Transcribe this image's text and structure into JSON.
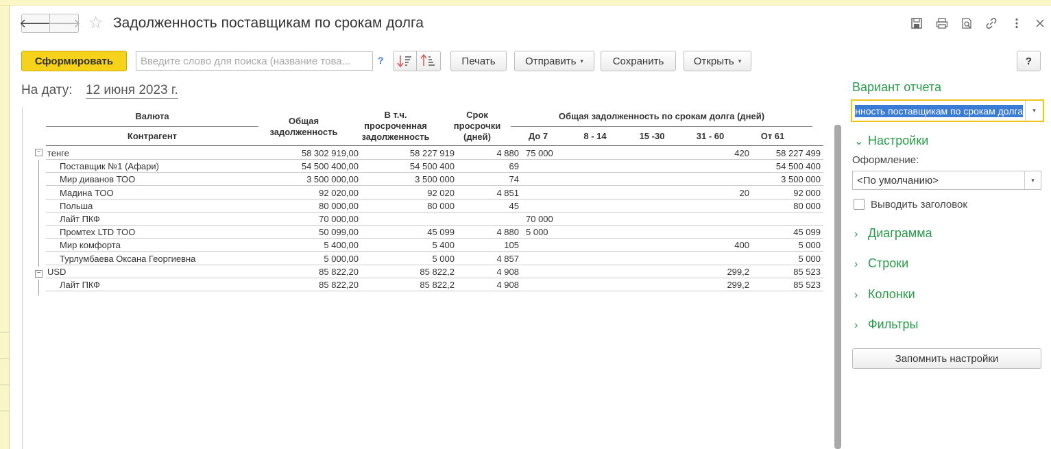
{
  "window": {
    "title": "Задолженность поставщикам по срокам долга",
    "back_glyph": "🡐",
    "forward_glyph": "🡒",
    "star_glyph": "☆",
    "icons": [
      "save-icon",
      "print-icon",
      "preview-icon",
      "link-icon",
      "more-icon",
      "close-icon"
    ]
  },
  "toolbar": {
    "generate_label": "Сформировать",
    "search_placeholder": "Введите слово для поиска (название това...",
    "search_help": "?",
    "print_label": "Печать",
    "send_label": "Отправить",
    "save_label": "Сохранить",
    "open_label": "Открыть",
    "help_label": "?",
    "caret": "▾"
  },
  "report": {
    "date_label": "На дату:",
    "date_value": "12 июня 2023 г.",
    "headers": {
      "currency": "Валюта",
      "counterparty": "Контрагент",
      "total": "Общая задолженность",
      "overdue": "В т.ч. просроченная задолженность",
      "days": "Срок просрочки (дней)",
      "group": "Общая задолженность по срокам долга (дней)",
      "b1": "До 7",
      "b2": "8 - 14",
      "b3": "15 -30",
      "b4": "31 - 60",
      "b5": "От 61"
    },
    "rows": [
      {
        "name": "тенге",
        "total": "58 302 919,00",
        "overdue": "58 227 919",
        "days": "4 880",
        "b1": "75 000",
        "b2": "",
        "b3": "",
        "b4": "420",
        "b5": "58 227 499",
        "group": true
      },
      {
        "name": "Поставщик №1 (Афари)",
        "total": "54 500 400,00",
        "overdue": "54 500 400",
        "days": "69",
        "b1": "",
        "b2": "",
        "b3": "",
        "b4": "",
        "b5": "54 500 400"
      },
      {
        "name": "Мир диванов ТОО",
        "total": "3 500 000,00",
        "overdue": "3 500 000",
        "days": "74",
        "b1": "",
        "b2": "",
        "b3": "",
        "b4": "",
        "b5": "3 500 000"
      },
      {
        "name": "Мадина ТОО",
        "total": "92 020,00",
        "overdue": "92 020",
        "days": "4 851",
        "b1": "",
        "b2": "",
        "b3": "",
        "b4": "20",
        "b5": "92 000"
      },
      {
        "name": "Польша",
        "total": "80 000,00",
        "overdue": "80 000",
        "days": "45",
        "b1": "",
        "b2": "",
        "b3": "",
        "b4": "",
        "b5": "80 000"
      },
      {
        "name": "Лайт ПКФ",
        "total": "70 000,00",
        "overdue": "",
        "days": "",
        "b1": "70 000",
        "b2": "",
        "b3": "",
        "b4": "",
        "b5": ""
      },
      {
        "name": "Промтех LTD ТОО",
        "total": "50 099,00",
        "overdue": "45 099",
        "days": "4 880",
        "b1": "5 000",
        "b2": "",
        "b3": "",
        "b4": "",
        "b5": "45 099"
      },
      {
        "name": "Мир комфорта",
        "total": "5 400,00",
        "overdue": "5 400",
        "days": "105",
        "b1": "",
        "b2": "",
        "b3": "",
        "b4": "400",
        "b5": "5 000"
      },
      {
        "name": "Турлумбаева Оксана Георгиевна",
        "total": "5 000,00",
        "overdue": "5 000",
        "days": "4 857",
        "b1": "",
        "b2": "",
        "b3": "",
        "b4": "",
        "b5": "5 000"
      },
      {
        "name": "USD",
        "total": "85 822,20",
        "overdue": "85 822,2",
        "days": "4 908",
        "b1": "",
        "b2": "",
        "b3": "",
        "b4": "299,2",
        "b5": "85 523",
        "group": true
      },
      {
        "name": "Лайт ПКФ",
        "total": "85 822,20",
        "overdue": "85 822,2",
        "days": "4 908",
        "b1": "",
        "b2": "",
        "b3": "",
        "b4": "299,2",
        "b5": "85 523"
      }
    ]
  },
  "panel": {
    "variant_title": "Вариант отчета",
    "variant_value": "Задолженность поставщикам по срокам долга",
    "settings_label": "Настройки",
    "format_label": "Оформление:",
    "format_value": "<По умолчанию>",
    "show_header_label": "Выводить заголовок",
    "show_header_checked": false,
    "diagram_label": "Диаграмма",
    "rows_label": "Строки",
    "columns_label": "Колонки",
    "filters_label": "Фильтры",
    "remember_label": "Запомнить настройки",
    "accent": "#2a9a4b"
  }
}
